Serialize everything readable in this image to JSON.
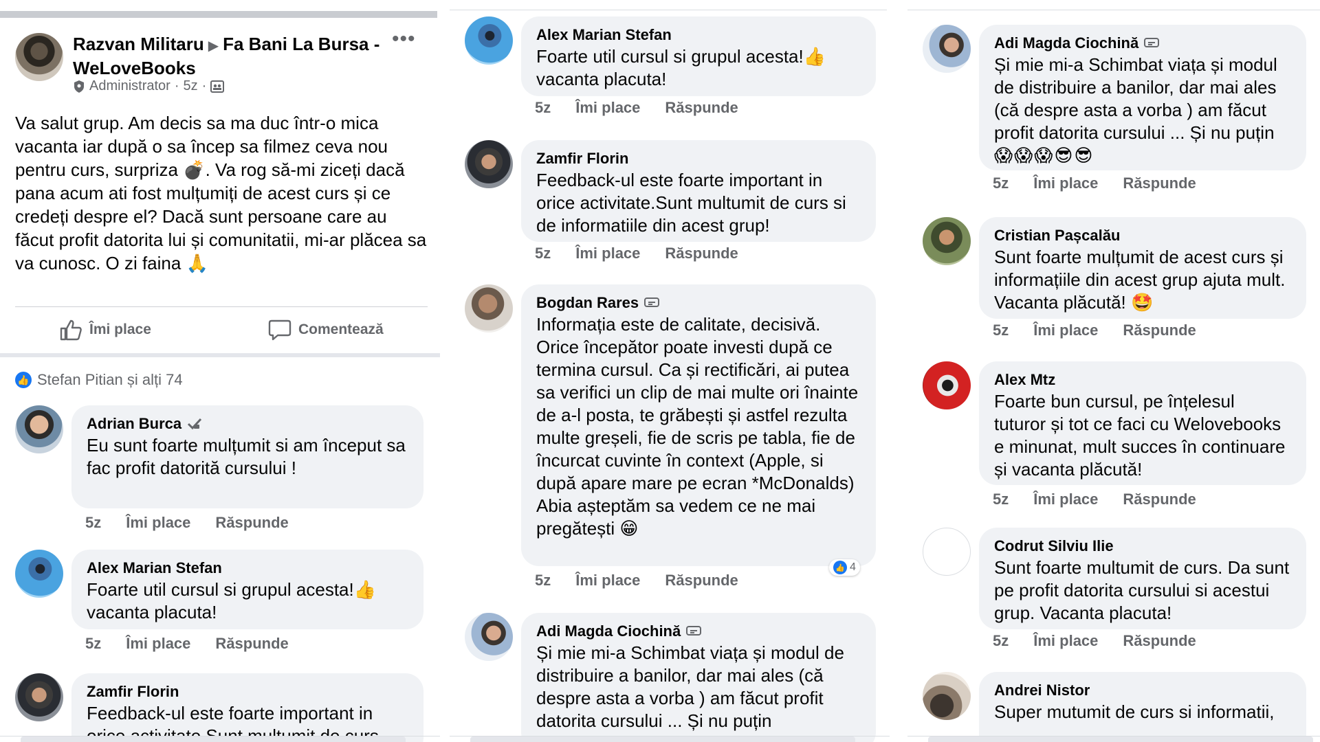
{
  "post": {
    "author": "Razvan Militaru",
    "group": "Fa Bani La Bursa - WeLoveBooks",
    "role": "Administrator",
    "time": "5z",
    "text": "Va salut grup. Am decis sa ma duc într-o mica vacanta iar după o sa încep sa filmez ceva nou pentru curs, surpriza 💣. Va rog să-mi ziceți dacă pana acum ati fost mulțumiți de acest curs și ce credeți despre el? Dacă sunt persoane care au făcut profit datorita lui și comunitatii, mi-ar plăcea sa va cunosc. O zi faina 🙏",
    "like_label": "Îmi place",
    "comment_label": "Comentează",
    "reactions_text": "Stefan Pitian și alți 74"
  },
  "labels": {
    "like": "Îmi place",
    "reply": "Răspunde"
  },
  "left_comments": [
    {
      "name": "Adrian Burca",
      "text": "Eu sunt foarte mulțumit si am început sa fac profit datorită cursului !",
      "time": "5z"
    },
    {
      "name": "Alex Marian Stefan",
      "text": "Foarte util cursul si grupul acesta!👍 vacanta placuta!",
      "time": "5z"
    },
    {
      "name": "Zamfir Florin",
      "text": "Feedback-ul este foarte important in orice activitate.Sunt multumit de curs",
      "time": "5z"
    }
  ],
  "middle_comments": [
    {
      "name": "Alex Marian Stefan",
      "text": "Foarte util cursul si grupul acesta!👍 vacanta placuta!",
      "time": "5z"
    },
    {
      "name": "Zamfir Florin",
      "text": "Feedback-ul este foarte important in orice activitate.Sunt multumit de curs si de informatiile din acest grup!",
      "time": "5z"
    },
    {
      "name": "Bogdan Rares",
      "text": "Informația este de calitate, decisivă. Orice începător poate investi după ce termina cursul. Ca și rectificări, ai putea sa verifici un clip de mai multe ori înainte de a-l posta, te grăbești și astfel rezulta multe greșeli, fie de scris pe tabla, fie de încurcat cuvinte în context (Apple, si după apare mare pe ecran *McDonalds)\nAbia așteptăm sa vedem ce ne mai pregătești 😁",
      "time": "5z",
      "reactions": "4"
    },
    {
      "name": "Adi Magda Ciochină",
      "text": "Și mie mi-a Schimbat viața și modul de distribuire a banilor, dar mai ales (că despre asta a vorba ) am făcut profit datorita cursului ... Și nu puțin",
      "time": ""
    }
  ],
  "right_comments": [
    {
      "name": "Adi Magda Ciochină",
      "text": "Și mie mi-a Schimbat viața și modul de distribuire a banilor, dar mai ales (că despre asta a vorba ) am făcut profit datorita cursului ... Și nu puțin",
      "emojis": "😱😱😱😎😎",
      "time": "5z"
    },
    {
      "name": "Cristian Pașcalău",
      "text": "Sunt foarte mulțumit de acest curs și informațiile din acest grup ajuta mult. Vacanta plăcută! 🤩",
      "time": "5z"
    },
    {
      "name": "Alex Mtz",
      "text": "Foarte bun cursul, pe înțelesul tuturor și tot ce faci cu Welovebooks e minunat, mult succes în continuare și vacanta plăcută!",
      "time": "5z"
    },
    {
      "name": "Codrut Silviu Ilie",
      "text": "Sunt foarte multumit de curs. Da sunt pe profit datorita cursului si acestui grup. Vacanta placuta!",
      "time": "5z"
    },
    {
      "name": "Andrei Nistor",
      "text": "Super mutumit de curs si informatii,",
      "time": ""
    }
  ],
  "colors": {
    "text": "#050505",
    "secondary": "#65676b",
    "bubble": "#f0f2f5",
    "accent": "#1877f2"
  },
  "icons": [
    "shield-icon",
    "group-privacy-icon",
    "more-options-icon",
    "like-thumb-icon",
    "comment-icon",
    "like-badge-icon",
    "verified-badge-icon",
    "top-fan-badge-icon"
  ]
}
